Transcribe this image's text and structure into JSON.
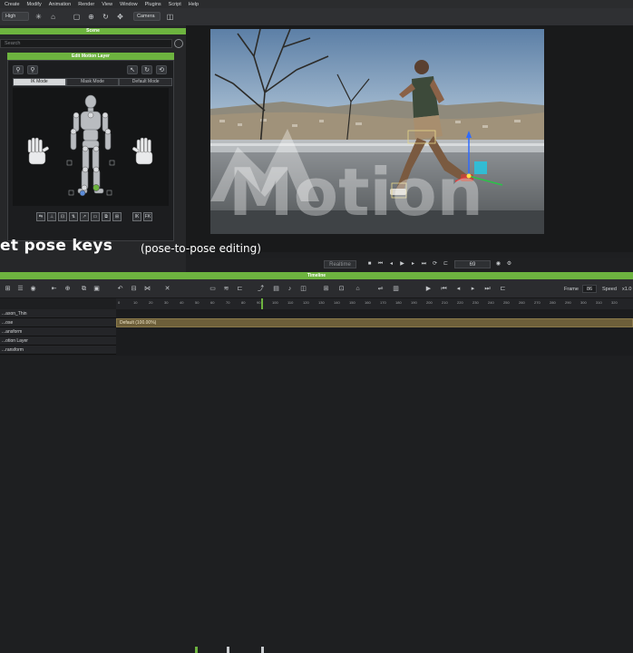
{
  "menu": [
    "Create",
    "Modify",
    "Animation",
    "Render",
    "View",
    "Window",
    "Plugins",
    "Script",
    "Help"
  ],
  "toolbar": {
    "size_value": "High",
    "camera_value": "Camera"
  },
  "scene_panel": {
    "title": "Scene",
    "search_placeholder": "Search"
  },
  "edit_motion_layer": {
    "title": "Edit Motion Layer",
    "modes": [
      "IK Mode",
      "Mask Mode",
      "Default Mode"
    ],
    "bottom_buttons": [
      "IK",
      "FK"
    ]
  },
  "caption": {
    "main": "et pose keys",
    "sub": "(pose-to-pose editing)"
  },
  "playback": {
    "mode": "Realtime",
    "frame_field": "69"
  },
  "timeline": {
    "title": "Timeline",
    "frame_label": "Frame",
    "frame_value": "86",
    "speed_label": "Speed",
    "speed_value": "x1.0",
    "ruler_ticks": [
      "0",
      "10",
      "20",
      "30",
      "40",
      "50",
      "60",
      "70",
      "80",
      "90",
      "100",
      "110",
      "120",
      "130",
      "140",
      "150",
      "160",
      "170",
      "180",
      "190",
      "200",
      "210",
      "220",
      "230",
      "240",
      "250",
      "260",
      "270",
      "280",
      "290",
      "300",
      "310",
      "320"
    ],
    "tracks": [
      {
        "name": "...ason_Thin",
        "bar_label": ""
      },
      {
        "name": "...ose",
        "bar_label": "Default (100.00%)"
      },
      {
        "name": "...ansform",
        "bar_label": ""
      },
      {
        "name": "...otion Layer",
        "bar_label": ""
      },
      {
        "name": "...ransform",
        "bar_label": ""
      }
    ]
  },
  "watermark": "Motion",
  "colors": {
    "accent": "#6db33f",
    "panel": "#262729",
    "track_bar": "#7a6a3c"
  }
}
